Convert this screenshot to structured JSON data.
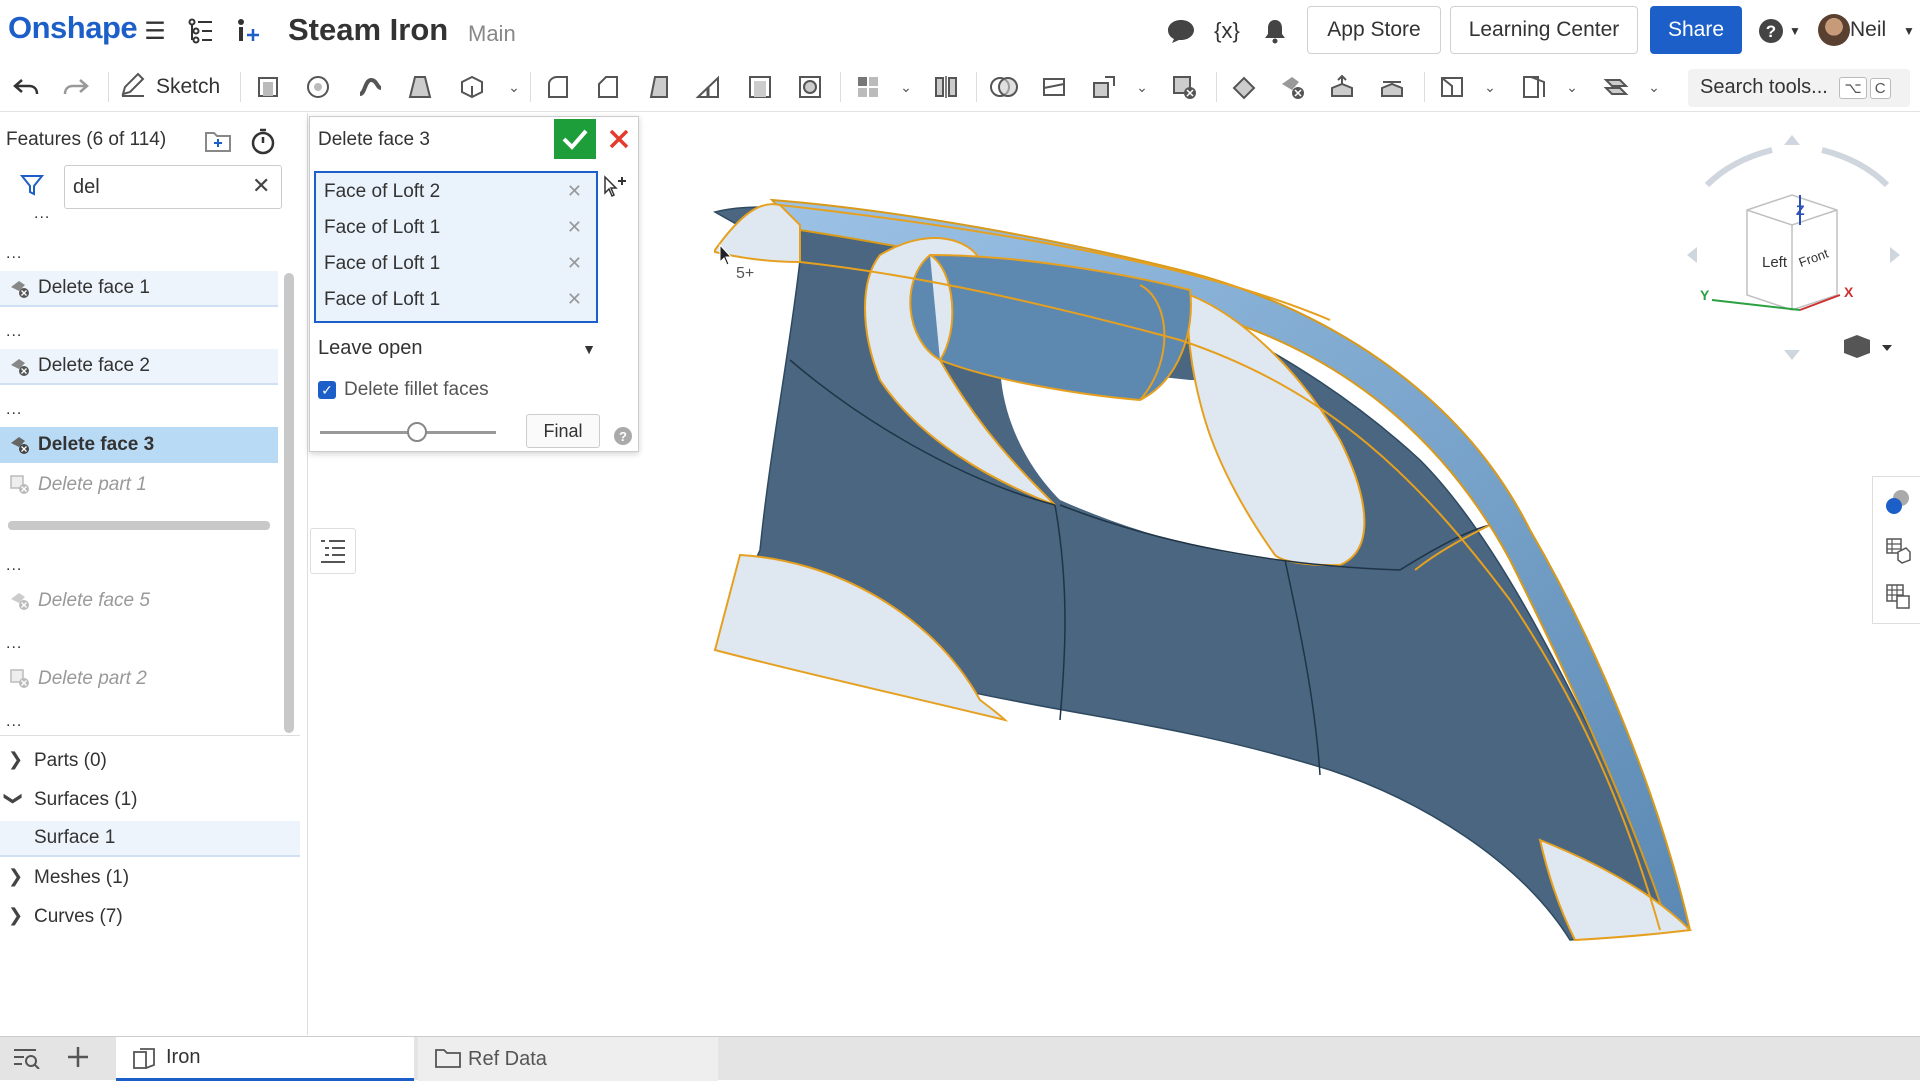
{
  "app": {
    "logo": "Onshape",
    "doc_title": "Steam Iron",
    "branch": "Main",
    "app_store": "App Store",
    "learning_center": "Learning Center",
    "share": "Share",
    "user": "Neil",
    "accent": "#1d5fc8"
  },
  "toolbar": {
    "sketch_label": "Sketch",
    "search_placeholder": "Search tools...",
    "search_kbd1": "⌥",
    "search_kbd2": "C"
  },
  "features": {
    "title": "Features (6 of 114)",
    "filter_value": "del",
    "items": [
      {
        "label": "Delete face 1",
        "state": "highlight"
      },
      {
        "label": "Delete face 2",
        "state": "highlight"
      },
      {
        "label": "Delete face 3",
        "state": "selected"
      },
      {
        "label": "Delete part 1",
        "state": "suppressed"
      },
      {
        "label": "Delete face 5",
        "state": "suppressed"
      },
      {
        "label": "Delete part 2",
        "state": "suppressed"
      }
    ],
    "ellipsis": "...",
    "groups": [
      {
        "label": "Parts (0)",
        "expanded": false
      },
      {
        "label": "Surfaces (1)",
        "expanded": true
      },
      {
        "label": "Meshes (1)",
        "expanded": false
      },
      {
        "label": "Curves (7)",
        "expanded": false
      }
    ],
    "surface_item": "Surface 1"
  },
  "dialog": {
    "title": "Delete face 3",
    "selections": [
      "Face of Loft 2",
      "Face of Loft 1",
      "Face of Loft 1",
      "Face of Loft 1"
    ],
    "dropdown_value": "Leave open",
    "checkbox_label": "Delete fillet faces",
    "checkbox_checked": true,
    "final_label": "Final",
    "slider_value": 0.55
  },
  "viewport": {
    "cursor_badge": "5+",
    "view_cube": {
      "top": "Z",
      "left_face": "Left",
      "right_face": "Front",
      "axis_x": "X",
      "axis_y": "Y"
    }
  },
  "tabs": [
    {
      "label": "Iron",
      "active": true
    },
    {
      "label": "Ref Data",
      "active": false
    }
  ]
}
